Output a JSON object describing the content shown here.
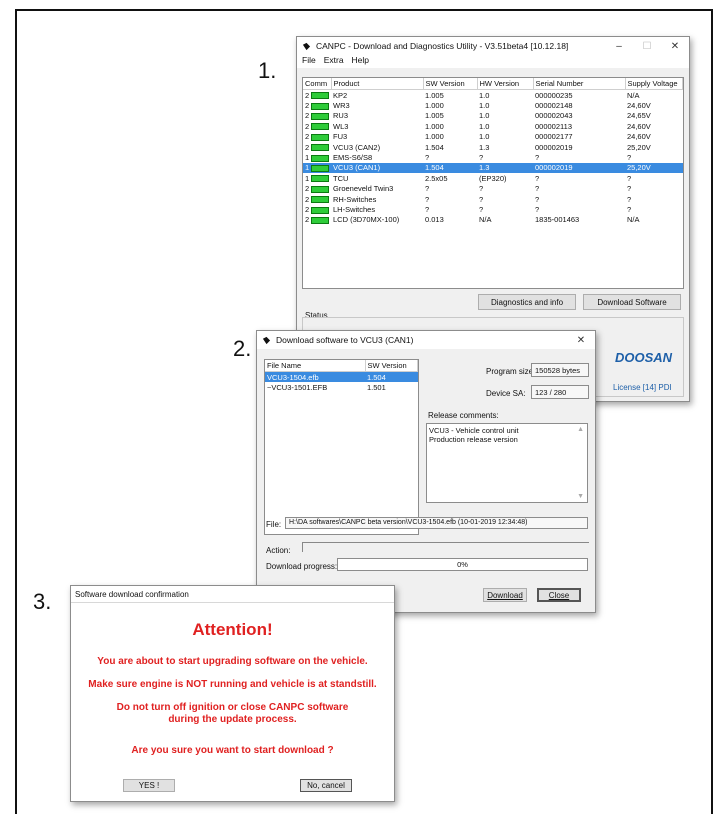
{
  "steps": {
    "s1": "1.",
    "s2": "2.",
    "s3": "3."
  },
  "main_window": {
    "title": "CANPC - Download and Diagnostics Utility - V3.51beta4 [10.12.18]",
    "menu": [
      "File",
      "Extra",
      "Help"
    ],
    "columns": [
      "Comm",
      "Product",
      "SW Version",
      "HW Version",
      "Serial Number",
      "Supply Voltage"
    ],
    "rows": [
      {
        "comm": "2",
        "product": "KP2",
        "sw": "1.005",
        "hw": "1.0",
        "serial": "000000235",
        "voltage": "N/A"
      },
      {
        "comm": "2",
        "product": "WR3",
        "sw": "1.000",
        "hw": "1.0",
        "serial": "000002148",
        "voltage": "24,60V"
      },
      {
        "comm": "2",
        "product": "RU3",
        "sw": "1.005",
        "hw": "1.0",
        "serial": "000002043",
        "voltage": "24,65V"
      },
      {
        "comm": "2",
        "product": "WL3",
        "sw": "1.000",
        "hw": "1.0",
        "serial": "000002113",
        "voltage": "24,60V"
      },
      {
        "comm": "2",
        "product": "FU3",
        "sw": "1.000",
        "hw": "1.0",
        "serial": "000002177",
        "voltage": "24,60V"
      },
      {
        "comm": "2",
        "product": "VCU3 (CAN2)",
        "sw": "1.504",
        "hw": "1.3",
        "serial": "000002019",
        "voltage": "25,20V"
      },
      {
        "comm": "1",
        "product": "EMS-S6/S8",
        "sw": "?",
        "hw": "?",
        "serial": "?",
        "voltage": "?"
      },
      {
        "comm": "1",
        "product": "VCU3 (CAN1)",
        "sw": "1.504",
        "hw": "1.3",
        "serial": "000002019",
        "voltage": "25,20V"
      },
      {
        "comm": "1",
        "product": "TCU",
        "sw": "2.5x05",
        "hw": "(EP320)",
        "serial": "?",
        "voltage": "?"
      },
      {
        "comm": "2",
        "product": "Groeneveld Twin3",
        "sw": "?",
        "hw": "?",
        "serial": "?",
        "voltage": "?"
      },
      {
        "comm": "2",
        "product": "RH-Switches",
        "sw": "?",
        "hw": "?",
        "serial": "?",
        "voltage": "?"
      },
      {
        "comm": "2",
        "product": "LH-Switches",
        "sw": "?",
        "hw": "?",
        "serial": "?",
        "voltage": "?"
      },
      {
        "comm": "2",
        "product": "LCD (3D70MX-100)",
        "sw": "0.013",
        "hw": "N/A",
        "serial": "1835-001463",
        "voltage": "N/A"
      }
    ],
    "selected_row": 7,
    "diag_button": "Diagnostics and info",
    "download_button": "Download Software",
    "status_label": "Status",
    "brand": "DOOSAN",
    "license": "License [14] PDI"
  },
  "download_window": {
    "title": "Download software to VCU3 (CAN1)",
    "file_columns": [
      "File Name",
      "SW Version"
    ],
    "files": [
      {
        "name": "VCU3-1504.efb",
        "version": "1.504"
      },
      {
        "name": "~VCU3-1501.EFB",
        "version": "1.501"
      }
    ],
    "selected_file": 0,
    "program_size_label": "Program size:",
    "program_size_value": "150528 bytes",
    "device_sa_label": "Device SA:",
    "device_sa_value": "123 / 280",
    "release_comments_label": "Release comments:",
    "release_comments_line1": "VCU3 - Vehicle control unit",
    "release_comments_line2": "Production release version",
    "file_label": "File:",
    "file_path": "H:\\DA softwares\\CANPC beta version\\VCU3-1504.efb (10-01-2019 12:34:48)",
    "action_label": "Action:",
    "progress_label": "Download progress:",
    "progress_text": "0%",
    "progress_value": 0,
    "download_button": "Download",
    "close_button": "Close"
  },
  "confirm_window": {
    "title": "Software download confirmation",
    "heading": "Attention!",
    "line1": "You are about to start upgrading software on the vehicle.",
    "line2": "Make sure engine is NOT running and vehicle is at standstill.",
    "line3": "Do not turn off ignition or close CANPC software",
    "line4": "during the update process.",
    "line5": "Are you sure you want to start download ?",
    "yes_button": "YES !",
    "no_button": "No, cancel"
  },
  "colors": {
    "accent": "#3a8be0",
    "led": "#2fcc3a",
    "warning": "#e02121",
    "brand": "#1d5fa8"
  }
}
